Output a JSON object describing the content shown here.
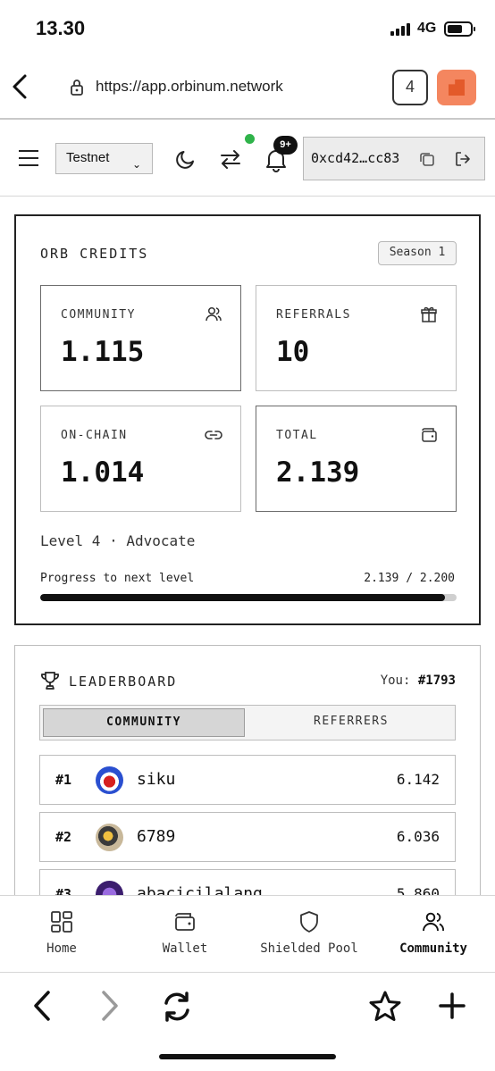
{
  "status": {
    "time": "13.30",
    "network": "4G"
  },
  "browser": {
    "url": "https://app.orbinum.network",
    "tab_count": "4"
  },
  "header": {
    "network": "Testnet",
    "notifications": "9+",
    "wallet_address": "0xcd42…cc83"
  },
  "credits": {
    "title": "ORB CREDITS",
    "season": "Season 1",
    "community_label": "COMMUNITY",
    "community_value": "1.115",
    "referrals_label": "REFERRALS",
    "referrals_value": "10",
    "onchain_label": "ON-CHAIN",
    "onchain_value": "1.014",
    "total_label": "TOTAL",
    "total_value": "2.139",
    "level": "Level 4 · Advocate",
    "progress_label": "Progress to next level",
    "progress_value": "2.139 / 2.200",
    "progress_fraction": 0.972
  },
  "leaderboard": {
    "title": "LEADERBOARD",
    "you_label": "You:",
    "you_rank": "#1793",
    "tabs": [
      "COMMUNITY",
      "REFERRERS"
    ],
    "rows": [
      {
        "rank": "#1",
        "name": "siku",
        "score": "6.142"
      },
      {
        "rank": "#2",
        "name": "6789",
        "score": "6.036"
      },
      {
        "rank": "#3",
        "name": "abacicilalang",
        "score": "5.860"
      }
    ]
  },
  "nav": {
    "home": "Home",
    "wallet": "Wallet",
    "shielded_pool": "Shielded Pool",
    "community": "Community"
  },
  "colors": {
    "accent_orange": "#f4865f",
    "online_green": "#2fb34a"
  }
}
